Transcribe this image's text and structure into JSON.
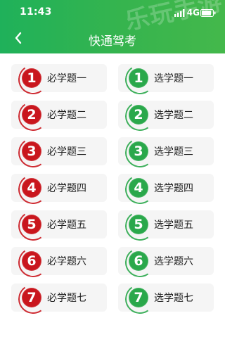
{
  "status_bar": {
    "time": "11:43",
    "network": "4G"
  },
  "header": {
    "title": "快通驾考",
    "watermark": "乐玩手游"
  },
  "rows": [
    {
      "left": {
        "number": "1",
        "label": "必学题一"
      },
      "right": {
        "number": "1",
        "label": "选学题一"
      }
    },
    {
      "left": {
        "number": "2",
        "label": "必学题二"
      },
      "right": {
        "number": "2",
        "label": "选学题二"
      }
    },
    {
      "left": {
        "number": "3",
        "label": "必学题三"
      },
      "right": {
        "number": "3",
        "label": "选学题三"
      }
    },
    {
      "left": {
        "number": "4",
        "label": "必学题四"
      },
      "right": {
        "number": "4",
        "label": "选学题四"
      }
    },
    {
      "left": {
        "number": "5",
        "label": "必学题五"
      },
      "right": {
        "number": "5",
        "label": "选学题五"
      }
    },
    {
      "left": {
        "number": "6",
        "label": "必学题六"
      },
      "right": {
        "number": "6",
        "label": "选学题六"
      }
    },
    {
      "left": {
        "number": "7",
        "label": "必学题七"
      },
      "right": {
        "number": "7",
        "label": "选学题七"
      }
    }
  ],
  "colors": {
    "header_green": "#2fb256",
    "badge_red": "#c9161d",
    "badge_green": "#2aa84b"
  },
  "icons": {
    "back": "chevron-left-icon",
    "signal": "signal-icon",
    "battery": "battery-icon"
  }
}
